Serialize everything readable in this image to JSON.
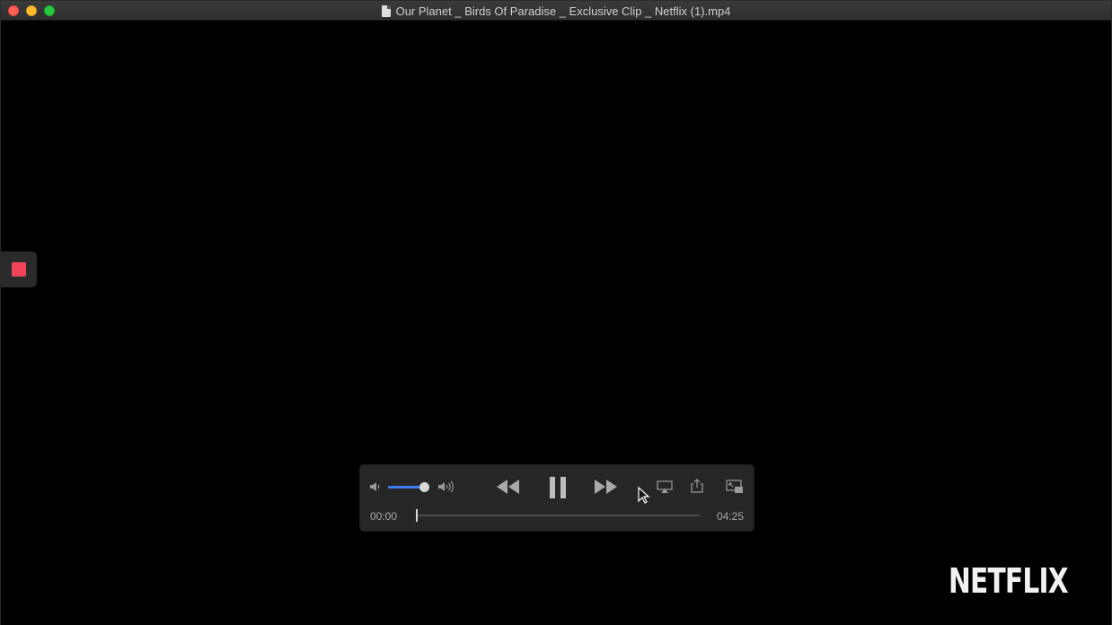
{
  "window": {
    "title": "Our Planet _ Birds Of Paradise _ Exclusive Clip _ Netflix (1).mp4"
  },
  "player": {
    "volume_level": 0.92,
    "playback_progress": 0.0,
    "current_time": "00:00",
    "duration": "04:25",
    "accent_color": "#3f7cf2"
  },
  "icons": {
    "volume_low": "speaker-low-icon",
    "volume_high": "speaker-high-icon",
    "rewind": "rewind-icon",
    "pause": "pause-icon",
    "fast_forward": "fast-forward-icon",
    "airplay": "airplay-icon",
    "share": "share-icon",
    "picture_in_picture": "picture-in-picture-icon",
    "stop": "stop-icon"
  },
  "overlay": {
    "logo_text": "NETFLIX"
  },
  "colors": {
    "record_stop": "#f0445a",
    "close": "#fe5f57",
    "minimize": "#febc2e",
    "maximize": "#28c840"
  }
}
